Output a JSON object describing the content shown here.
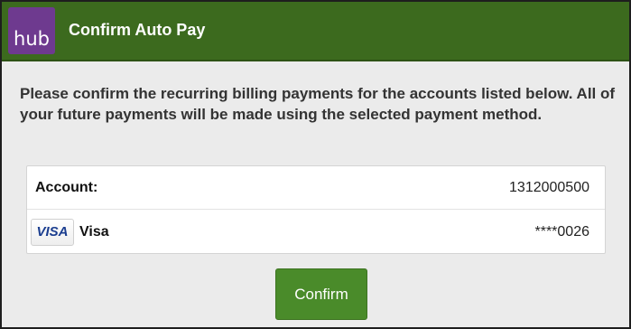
{
  "header": {
    "logo_text": "hub",
    "title": "Confirm Auto Pay"
  },
  "intro_text": "Please confirm the recurring billing payments for the accounts listed below. All of your future payments will be made using the selected payment method.",
  "account_row": {
    "label": "Account:",
    "value": "1312000500"
  },
  "payment_row": {
    "card_badge": "VISA",
    "card_name": "Visa",
    "masked_number": "****0026"
  },
  "confirm_label": "Confirm",
  "colors": {
    "header_bg": "#3c6a1e",
    "logo_bg": "#6e3a8f",
    "button_bg": "#4a8b2a",
    "page_bg": "#ebebeb"
  }
}
